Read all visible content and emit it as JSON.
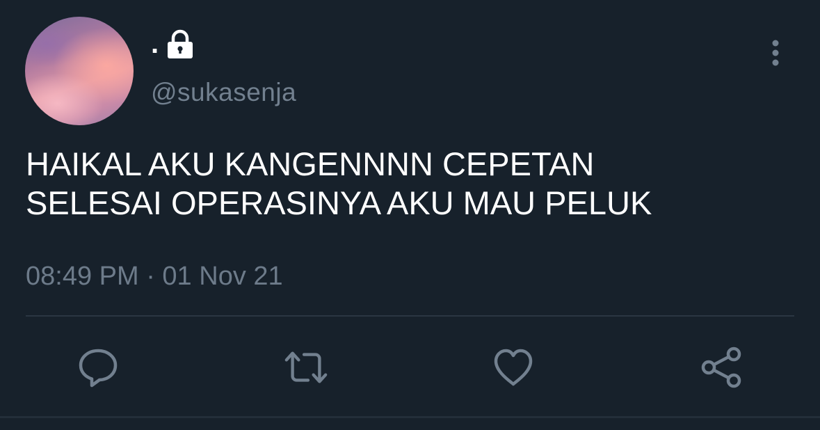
{
  "user": {
    "display_name": ".",
    "handle": "@sukasenja",
    "protected_icon": "lock-icon"
  },
  "tweet": {
    "lines": [
      "HAIKAL AKU KANGENNNN CEPETAN",
      "SELESAI OPERASINYA AKU MAU PELUK"
    ],
    "timestamp": "08:49 PM · 01 Nov 21"
  },
  "actions": [
    {
      "name": "reply",
      "icon": "comment-icon"
    },
    {
      "name": "retweet",
      "icon": "retweet-icon"
    },
    {
      "name": "like",
      "icon": "heart-icon"
    },
    {
      "name": "share",
      "icon": "share-icon"
    }
  ],
  "menu": {
    "icon": "more-vertical-icon"
  },
  "colors": {
    "background": "#17212b",
    "text_primary": "#ffffff",
    "text_secondary": "#6d7b8a",
    "icon": "#72808f",
    "divider": "#2b3642"
  }
}
